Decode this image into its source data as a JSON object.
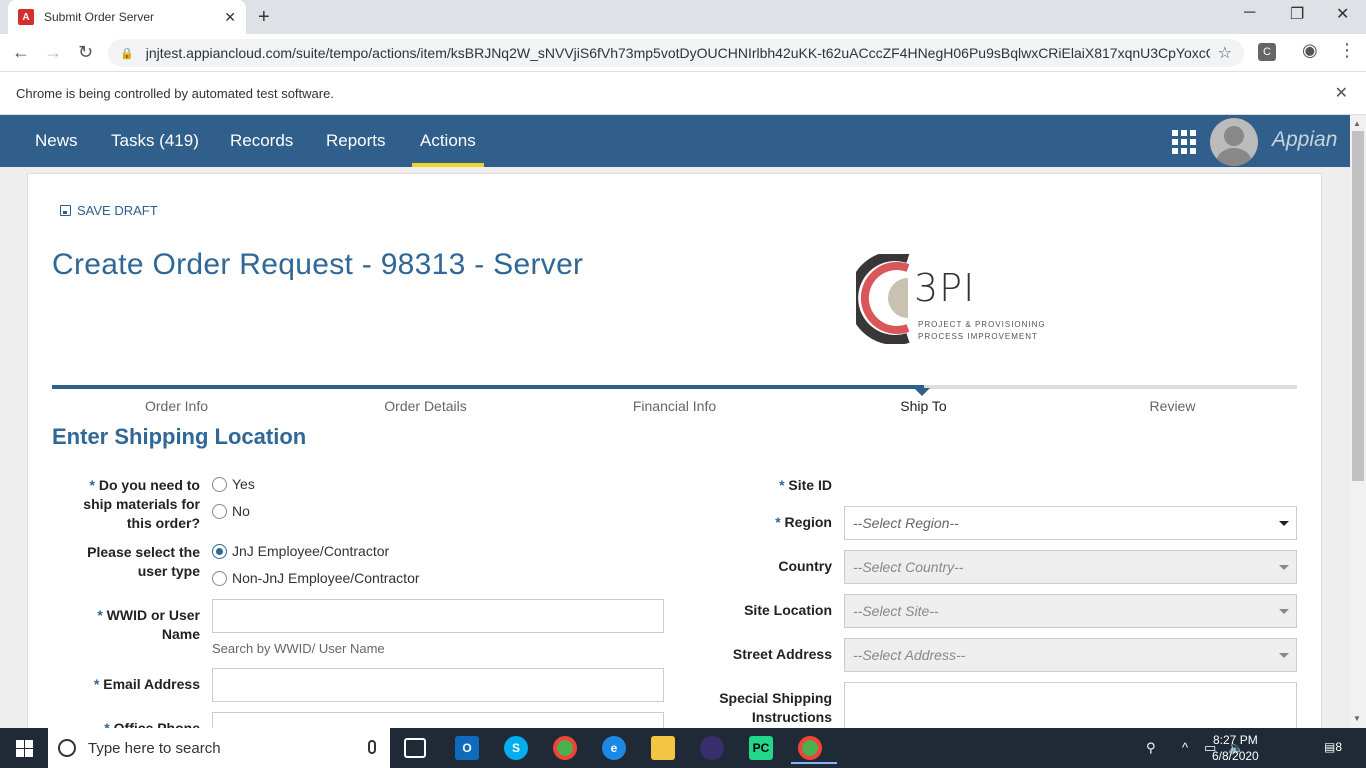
{
  "browser": {
    "tab_title": "Submit Order Server",
    "url": "jnjtest.appiancloud.com/suite/tempo/actions/item/ksBRJNq2W_sNVVjiS6fVh73mp5votDyOUCHNIrlbh42uKK-t62uACccZF4HNegH06Pu9sBqlwxCRiElaiX817xqnU3CpYoxcQ...",
    "infobar_text": "Chrome is being controlled by automated test software.",
    "ext_label": "C"
  },
  "appnav": {
    "items": [
      {
        "label": "News"
      },
      {
        "label": "Tasks (419)"
      },
      {
        "label": "Records"
      },
      {
        "label": "Reports"
      },
      {
        "label": "Actions"
      }
    ],
    "active": "Actions",
    "brand": "Appian"
  },
  "page": {
    "save_draft": "SAVE DRAFT",
    "title": "Create Order Request - 98313 - Server",
    "logo": {
      "big": "3PI",
      "line1": "PROJECT & PROVISIONING",
      "line2": "PROCESS IMPROVEMENT"
    },
    "steps": [
      {
        "label": "Order Info"
      },
      {
        "label": "Order Details"
      },
      {
        "label": "Financial Info"
      },
      {
        "label": "Ship To"
      },
      {
        "label": "Review"
      }
    ],
    "current_step": "Ship To",
    "section_title": "Enter Shipping Location"
  },
  "form": {
    "ship_q": {
      "required": "*",
      "label_line1": "Do you need to",
      "label_line2": "ship materials for",
      "label_line3": "this order?",
      "options": [
        "Yes",
        "No"
      ]
    },
    "user_type": {
      "label_line1": "Please select the",
      "label_line2": "user type",
      "options": [
        "JnJ Employee/Contractor",
        "Non-JnJ Employee/Contractor"
      ],
      "selected": "JnJ Employee/Contractor"
    },
    "wwid": {
      "required": "*",
      "label_line1": "WWID or User",
      "label_line2": "Name",
      "value": "",
      "hint": "Search by WWID/ User Name"
    },
    "email": {
      "required": "*",
      "label": "Email Address",
      "value": ""
    },
    "office_phone": {
      "required": "*",
      "label": "Office Phone"
    },
    "site_id": {
      "required": "*",
      "label": "Site ID"
    },
    "region": {
      "required": "*",
      "label": "Region",
      "placeholder": "--Select Region--"
    },
    "country": {
      "label": "Country",
      "placeholder": "--Select Country--"
    },
    "site_location": {
      "label": "Site Location",
      "placeholder": "--Select Site--"
    },
    "street_address": {
      "label": "Street Address",
      "placeholder": "--Select Address--"
    },
    "special": {
      "label_line1": "Special Shipping",
      "label_line2": "Instructions",
      "value": ""
    }
  },
  "taskbar": {
    "search_placeholder": "Type here to search",
    "time": "8:27 PM",
    "date": "6/8/2020",
    "notif_count": "8"
  },
  "colors": {
    "nav_bg": "#2f5f8a",
    "accent": "#2f6796",
    "active_underline": "#f2d22e"
  }
}
